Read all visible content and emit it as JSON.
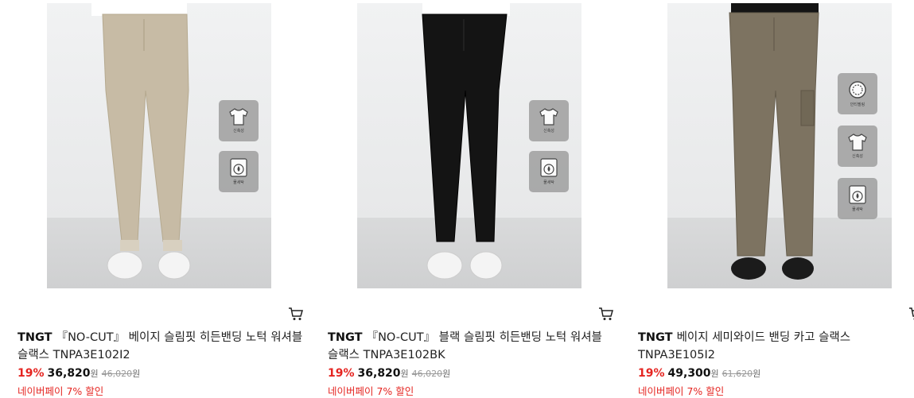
{
  "products": [
    {
      "brand": "TNGT",
      "name": "『NO-CUT』 베이지 슬림핏 히든밴딩 노턱 워셔블 슬랙스 TNPA3E102I2",
      "discount": "19%",
      "price": "36,820",
      "currency": "원",
      "original_price": "46,020",
      "original_currency": "원",
      "promo": "네이버페이 7% 할인",
      "pants_color": "#c7bba5",
      "shoe_color": "#f4f4f4",
      "badges": [
        {
          "icon": "tshirt-icon",
          "label": "신축성"
        },
        {
          "icon": "washing-machine-icon",
          "label": "물세탁"
        }
      ]
    },
    {
      "brand": "TNGT",
      "name": "『NO-CUT』 블랙 슬림핏 히든밴딩 노턱 워셔블 슬랙스 TNPA3E102BK",
      "discount": "19%",
      "price": "36,820",
      "currency": "원",
      "original_price": "46,020",
      "original_currency": "원",
      "promo": "네이버페이 7% 할인",
      "pants_color": "#141414",
      "shoe_color": "#f4f4f4",
      "badges": [
        {
          "icon": "tshirt-icon",
          "label": "신축성"
        },
        {
          "icon": "washing-machine-icon",
          "label": "물세탁"
        }
      ]
    },
    {
      "brand": "TNGT",
      "name": "베이지 세미와이드 밴딩 카고 슬랙스 TNPA3E105I2",
      "discount": "19%",
      "price": "49,300",
      "currency": "원",
      "original_price": "61,620",
      "original_currency": "원",
      "promo": "네이버페이 7% 할인",
      "pants_color": "#7d7361",
      "shoe_color": "#1b1b1b",
      "badges": [
        {
          "icon": "anti-pilling-icon",
          "label": "안티필링"
        },
        {
          "icon": "tshirt-icon",
          "label": "신축성"
        },
        {
          "icon": "washing-machine-icon",
          "label": "물세탁"
        }
      ]
    }
  ]
}
